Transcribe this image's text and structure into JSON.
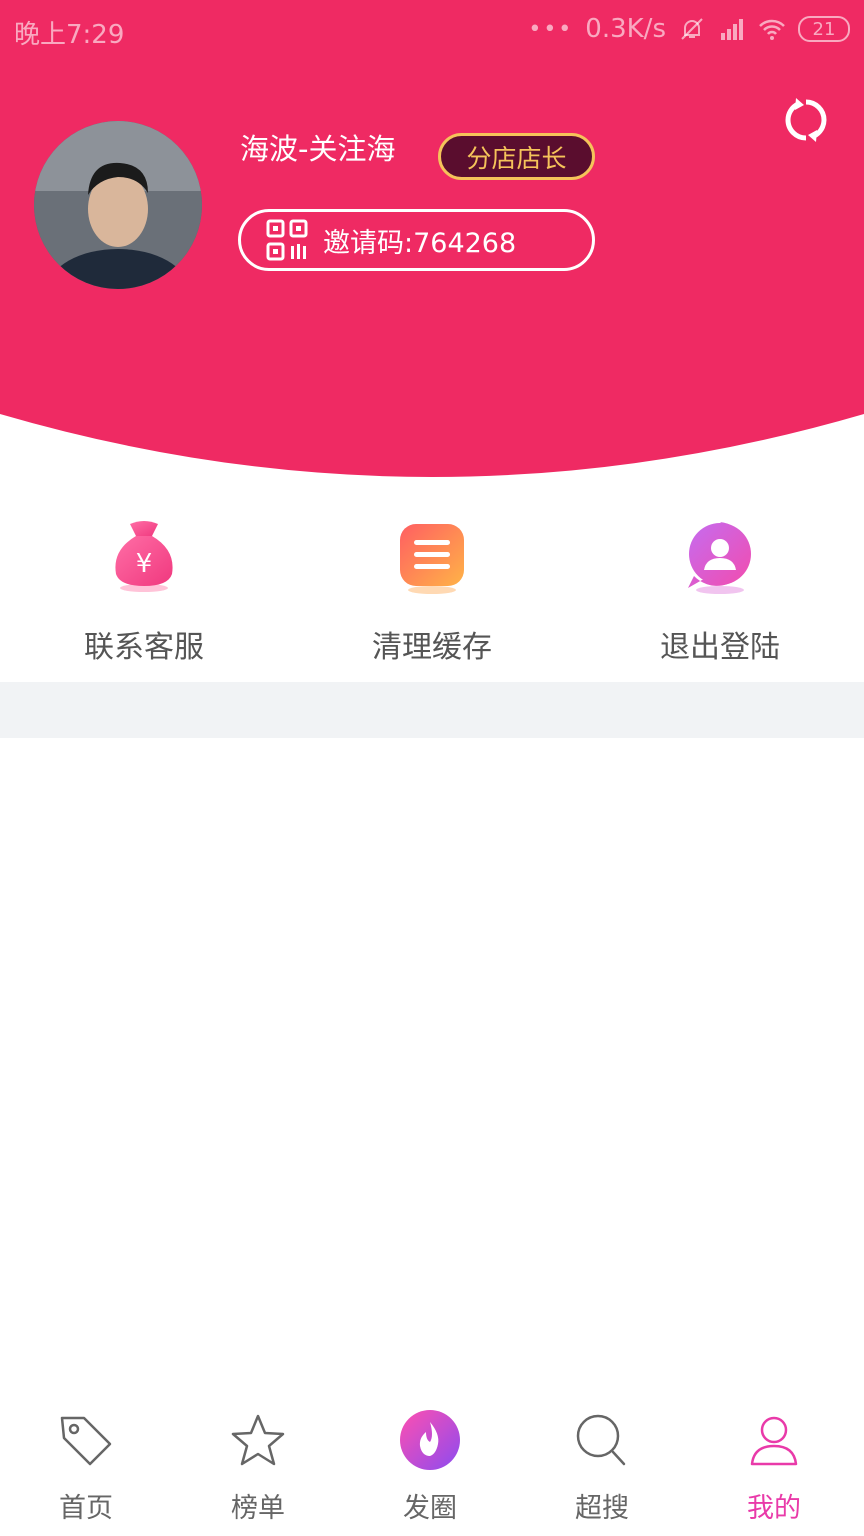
{
  "status_bar": {
    "time": "晚上7:29",
    "dots": "•••",
    "network_speed": "0.3K/s",
    "battery": "21"
  },
  "profile": {
    "username": "海波-关注海",
    "role_badge": "分店店长",
    "invite_code": "邀请码:764268"
  },
  "actions": [
    {
      "label": "联系客服",
      "icon": "money-bag-icon"
    },
    {
      "label": "清理缓存",
      "icon": "list-icon"
    },
    {
      "label": "退出登陆",
      "icon": "user-icon"
    }
  ],
  "tabs": [
    {
      "label": "首页",
      "icon": "tag-icon",
      "active": false
    },
    {
      "label": "榜单",
      "icon": "star-icon",
      "active": false
    },
    {
      "label": "发圈",
      "icon": "flame-icon",
      "active": false
    },
    {
      "label": "超搜",
      "icon": "search-icon",
      "active": false
    },
    {
      "label": "我的",
      "icon": "person-icon",
      "active": true
    }
  ],
  "colors": {
    "header_bg": "#ef2a63",
    "badge_bg": "#5a0d2e",
    "badge_text": "#f5c35a",
    "active_tab": "#e93aa9"
  }
}
